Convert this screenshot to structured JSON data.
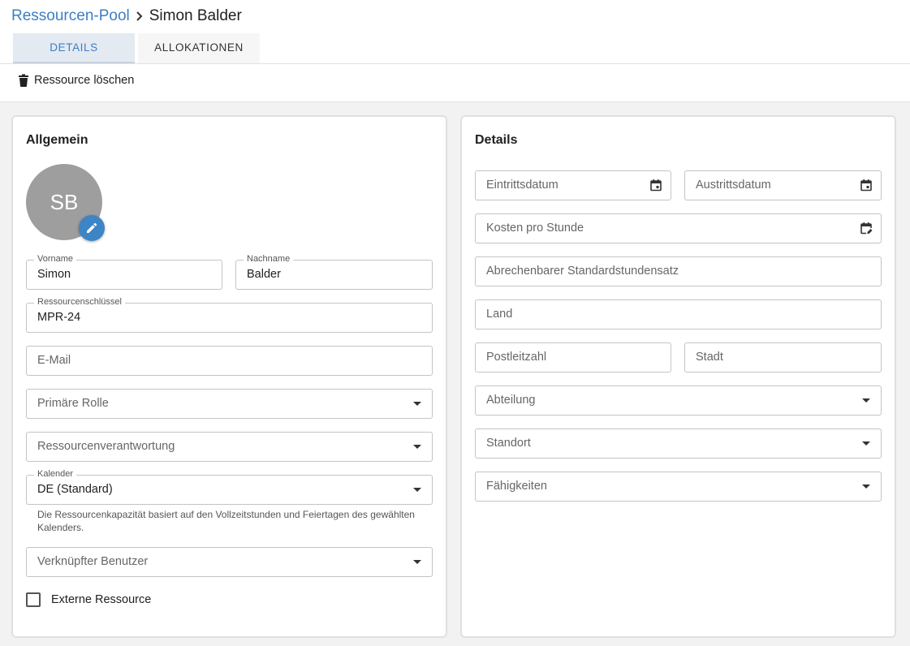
{
  "breadcrumb": {
    "parent": "Ressourcen-Pool",
    "current": "Simon Balder"
  },
  "tabs": [
    {
      "label": "DETAILS",
      "active": true
    },
    {
      "label": "ALLOKATIONEN",
      "active": false
    }
  ],
  "toolbar": {
    "delete_label": "Ressource löschen",
    "delete_icon": "trash-icon"
  },
  "general": {
    "title": "Allgemein",
    "avatar_initials": "SB",
    "avatar_edit_icon": "pencil-icon",
    "first_name": {
      "label": "Vorname",
      "value": "Simon"
    },
    "last_name": {
      "label": "Nachname",
      "value": "Balder"
    },
    "resource_key": {
      "label": "Ressourcenschlüssel",
      "value": "MPR-24"
    },
    "email": {
      "placeholder": "E-Mail"
    },
    "primary_role": {
      "placeholder": "Primäre Rolle"
    },
    "resource_manager": {
      "placeholder": "Ressourcenverantwortung"
    },
    "calendar": {
      "label": "Kalender",
      "value": "DE (Standard)",
      "helper": "Die Ressourcenkapazität basiert auf den Vollzeitstunden und Feiertagen des gewählten Kalenders."
    },
    "linked_user": {
      "placeholder": "Verknüpfter Benutzer"
    },
    "external": {
      "label": "Externe Ressource",
      "checked": false
    }
  },
  "details": {
    "title": "Details",
    "entry_date": {
      "placeholder": "Eintrittsdatum",
      "icon": "calendar-icon"
    },
    "exit_date": {
      "placeholder": "Austrittsdatum",
      "icon": "calendar-icon"
    },
    "cost_per_hour": {
      "placeholder": "Kosten pro Stunde",
      "icon": "calendar-edit-icon"
    },
    "billable_rate": {
      "placeholder": "Abrechenbarer Standardstundensatz"
    },
    "country": {
      "placeholder": "Land"
    },
    "postal_code": {
      "placeholder": "Postleitzahl"
    },
    "city": {
      "placeholder": "Stadt"
    },
    "department": {
      "placeholder": "Abteilung"
    },
    "location": {
      "placeholder": "Standort"
    },
    "skills": {
      "placeholder": "Fähigkeiten"
    }
  },
  "colors": {
    "accent": "#3b7fc4",
    "avatar_bg": "#9e9e9e",
    "edit_button": "#3d85c6",
    "page_bg": "#f2f2f2"
  }
}
